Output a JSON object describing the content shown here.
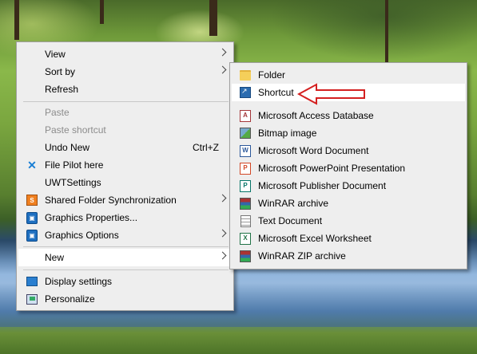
{
  "main_menu": {
    "items": [
      {
        "label": "View",
        "submenu": true
      },
      {
        "label": "Sort by",
        "submenu": true
      },
      {
        "label": "Refresh"
      },
      {
        "label": "Paste",
        "disabled": true
      },
      {
        "label": "Paste shortcut",
        "disabled": true
      },
      {
        "label": "Undo New",
        "shortcut": "Ctrl+Z"
      },
      {
        "label": "File Pilot here",
        "icon": "file-pilot-icon"
      },
      {
        "label": "UWTSettings"
      },
      {
        "label": "Shared Folder Synchronization",
        "icon": "shared-folder-sync-icon",
        "submenu": true
      },
      {
        "label": "Graphics Properties...",
        "icon": "intel-graphics-icon"
      },
      {
        "label": "Graphics Options",
        "icon": "intel-graphics-icon",
        "submenu": true
      },
      {
        "label": "New",
        "submenu": true,
        "highlighted": true
      },
      {
        "label": "Display settings",
        "icon": "display-icon"
      },
      {
        "label": "Personalize",
        "icon": "personalize-icon"
      }
    ]
  },
  "new_submenu": {
    "items": [
      {
        "label": "Folder",
        "icon": "folder-icon"
      },
      {
        "label": "Shortcut",
        "icon": "shortcut-icon",
        "highlighted": true
      },
      {
        "label": "Microsoft Access Database",
        "icon": "access-icon",
        "glyph": "A"
      },
      {
        "label": "Bitmap image",
        "icon": "bitmap-icon"
      },
      {
        "label": "Microsoft Word Document",
        "icon": "word-icon",
        "glyph": "W"
      },
      {
        "label": "Microsoft PowerPoint Presentation",
        "icon": "powerpoint-icon",
        "glyph": "P"
      },
      {
        "label": "Microsoft Publisher Document",
        "icon": "publisher-icon",
        "glyph": "P"
      },
      {
        "label": "WinRAR archive",
        "icon": "winrar-icon"
      },
      {
        "label": "Text Document",
        "icon": "text-document-icon"
      },
      {
        "label": "Microsoft Excel Worksheet",
        "icon": "excel-icon",
        "glyph": "X"
      },
      {
        "label": "WinRAR ZIP archive",
        "icon": "winrar-zip-icon"
      }
    ]
  },
  "annotation": {
    "color": "#d42020",
    "icon": "red-arrow-icon"
  },
  "colors": {
    "menu_bg": "#eeeeee",
    "highlight_bg": "#ffffff",
    "disabled_text": "#8c8c8c"
  }
}
